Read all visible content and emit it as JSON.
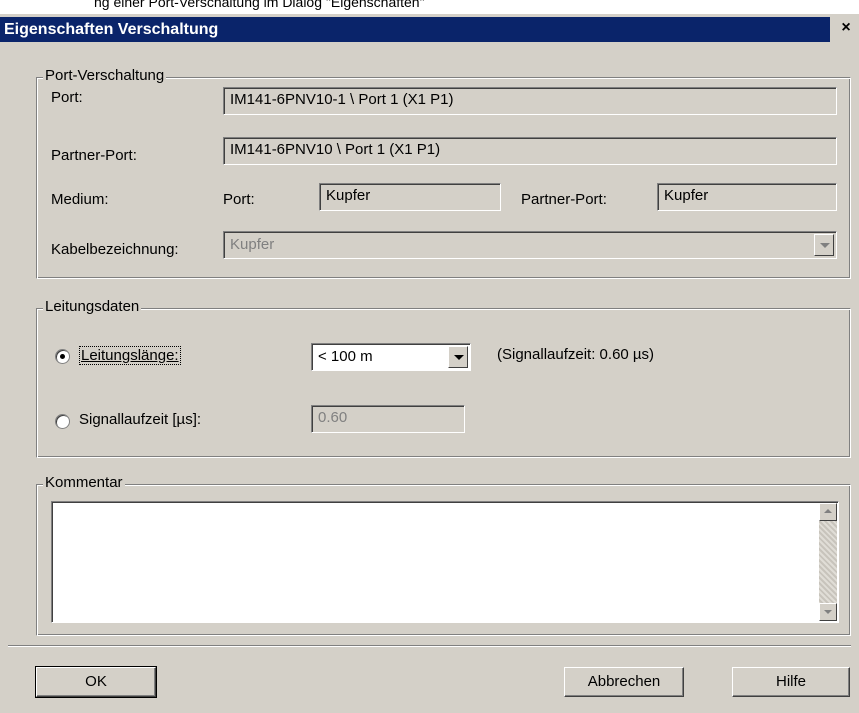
{
  "top_strip_text": "ng einer Port-Verschaltung im Dialog \"Eigenschaften\"",
  "window": {
    "title": "Eigenschaften Verschaltung",
    "close_label": "×"
  },
  "port_group": {
    "legend": "Port-Verschaltung",
    "port_label": "Port:",
    "port_value": "IM141-6PNV10-1 \\ Port 1 (X1 P1)",
    "partner_label": "Partner-Port:",
    "partner_value": "IM141-6PNV10 \\ Port 1 (X1 P1)",
    "medium_label": "Medium:",
    "medium_port_label": "Port:",
    "medium_port_value": "Kupfer",
    "medium_partner_label": "Partner-Port:",
    "medium_partner_value": "Kupfer",
    "cable_label": "Kabelbezeichnung:",
    "cable_value": "Kupfer"
  },
  "line_group": {
    "legend": "Leitungsdaten",
    "length_label": "Leitungslänge:",
    "length_checked": true,
    "length_value": "< 100 m",
    "signal_info": "(Signallaufzeit: 0.60 µs)",
    "signal_label": "Signallaufzeit [µs]:",
    "signal_checked": false,
    "signal_value": "0.60"
  },
  "comment_group": {
    "legend": "Kommentar",
    "value": ""
  },
  "buttons": {
    "ok": "OK",
    "cancel": "Abbrechen",
    "help": "Hilfe"
  }
}
